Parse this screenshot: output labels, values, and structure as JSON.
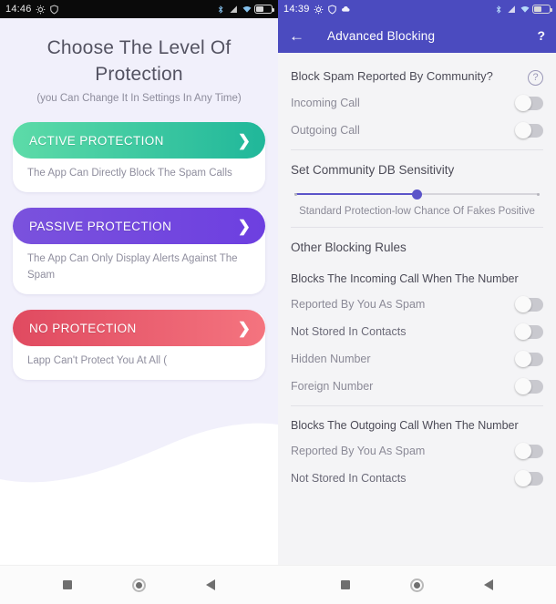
{
  "left": {
    "status": {
      "time": "14:46",
      "icons": [
        "gear-icon",
        "shield-icon",
        "bluetooth-icon",
        "signal-icon",
        "wifi-icon",
        "battery-icon"
      ]
    },
    "title": "Choose The Level Of Protection",
    "subtitle": "(you Can Change It In Settings In Any Time)",
    "options": [
      {
        "label": "ACTIVE PROTECTION",
        "desc": "The App Can Directly Block The Spam Calls",
        "chevron": "❯"
      },
      {
        "label": "PASSIVE PROTECTION",
        "desc": "The App Can Only Display Alerts Against The Spam",
        "chevron": "❯"
      },
      {
        "label": "NO PROTECTION",
        "desc": "Lapp Can't Protect You At All (",
        "chevron": "❯"
      }
    ]
  },
  "right": {
    "status": {
      "time": "14:39",
      "icons": [
        "gear-icon",
        "shield-icon",
        "cloud-icon",
        "bluetooth-icon",
        "signal-icon",
        "wifi-icon",
        "battery-icon"
      ]
    },
    "app_bar": {
      "back": "←",
      "title": "Advanced Blocking",
      "help": "?"
    },
    "community": {
      "heading": "Block Spam Reported By Community?",
      "help_icon": "?",
      "rows": [
        {
          "label": "Incoming Call",
          "state": "off"
        },
        {
          "label": "Outgoing Call",
          "state": "off"
        }
      ]
    },
    "sensitivity": {
      "title": "Set Community DB Sensitivity",
      "value_percent": 50,
      "caption": "Standard Protection-low Chance Of Fakes Positive"
    },
    "other_rules_title": "Other Blocking Rules",
    "incoming_group": {
      "heading": "Blocks The Incoming Call When The Number",
      "rows": [
        {
          "label": "Reported By You As Spam",
          "state": "off"
        },
        {
          "label": "Not Stored In Contacts",
          "state": "off"
        },
        {
          "label": "Hidden Number",
          "state": "off"
        },
        {
          "label": "Foreign Number",
          "state": "off"
        }
      ]
    },
    "outgoing_group": {
      "heading": "Blocks The Outgoing Call When The Number",
      "rows": [
        {
          "label": "Reported By You As Spam",
          "state": "off"
        },
        {
          "label": "Not Stored In Contacts",
          "state": "off"
        }
      ]
    }
  },
  "nav": {
    "recent": "recents-square",
    "home": "home-circle",
    "back": "back-triangle"
  },
  "colors": {
    "accent_purple": "#4b4bbf",
    "slider_purple": "#5b54c9",
    "green_start": "#5ddba8",
    "green_end": "#20b79a",
    "purple_start": "#7a52dd",
    "purple_end": "#6d3fe0",
    "red_start": "#e04a60",
    "red_end": "#f4747f",
    "left_bg": "#f1f0fb",
    "right_bg": "#f4f4f6"
  }
}
